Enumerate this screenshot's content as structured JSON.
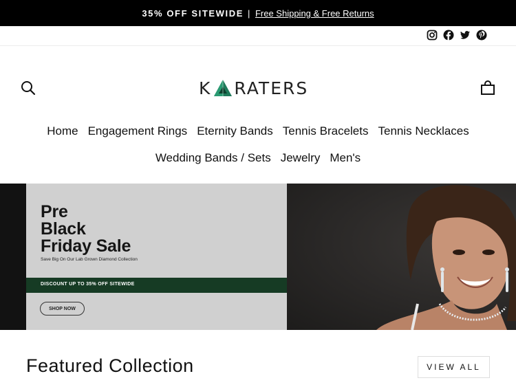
{
  "announcement": {
    "bold": "35% OFF SITEWIDE",
    "separator": "|",
    "link": "Free Shipping & Free Returns"
  },
  "social": {
    "icons": [
      "instagram-icon",
      "facebook-icon",
      "twitter-icon",
      "pinterest-icon"
    ]
  },
  "header": {
    "logo_k": "K",
    "logo_rest": "RATERS",
    "search_icon": "search-icon",
    "cart_icon": "cart-icon"
  },
  "nav": {
    "row1": [
      "Home",
      "Engagement Rings",
      "Eternity Bands",
      "Tennis Bracelets",
      "Tennis Necklaces"
    ],
    "row2": [
      "Wedding Bands / Sets",
      "Jewelry",
      "Men's"
    ]
  },
  "hero": {
    "title_line1": "Pre",
    "title_line2": "Black",
    "title_line3": "Friday Sale",
    "subtitle": "Save Big On Our Lab Grown Diamond Collection",
    "band_text": "DISCOUNT UP TO 35% OFF SITEWIDE",
    "button": "SHOP NOW"
  },
  "featured": {
    "title": "Featured Collection",
    "view_all": "VIEW ALL"
  },
  "colors": {
    "announcement_bg": "#000000",
    "accent_green": "#163b24",
    "logo_emerald": "#1f7a5a"
  }
}
